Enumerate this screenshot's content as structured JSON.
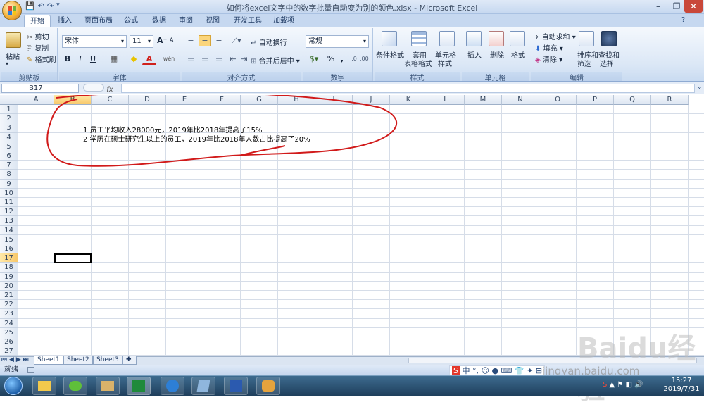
{
  "window": {
    "title": "如何将excel文字中的数字批量自动变为别的颜色.xlsx - Microsoft Excel",
    "controls": {
      "minimize": "–",
      "maximize": "❐",
      "close": "✕"
    }
  },
  "quick_access": {
    "save": "💾",
    "undo": "↶",
    "redo": "↷"
  },
  "ribbon_tabs": [
    "开始",
    "插入",
    "页面布局",
    "公式",
    "数据",
    "审阅",
    "视图",
    "开发工具",
    "加载项"
  ],
  "active_tab": "开始",
  "ribbon": {
    "clipboard": {
      "paste": "粘贴",
      "cut": "剪切",
      "copy": "复制",
      "format_painter": "格式刷",
      "label": "剪贴板"
    },
    "font": {
      "name": "宋体",
      "size": "11",
      "grow": "A⁺",
      "shrink": "A⁻",
      "bold": "B",
      "italic": "I",
      "underline": "U",
      "border": "▦",
      "fill": "◆",
      "color": "A",
      "wen": "wén",
      "label": "字体"
    },
    "alignment": {
      "wrap": "自动换行",
      "merge": "合并后居中",
      "label": "对齐方式"
    },
    "number": {
      "format": "常规",
      "percent": "%",
      "comma": ",",
      "label": "数字"
    },
    "styles": {
      "conditional": "条件格式",
      "table_format_1": "套用",
      "table_format_2": "表格格式",
      "cell_style_1": "单元格",
      "cell_style_2": "样式",
      "label": "样式"
    },
    "cells": {
      "insert": "插入",
      "delete": "删除",
      "format": "格式",
      "label": "单元格"
    },
    "editing": {
      "autosum": "自动求和",
      "fill": "填充",
      "clear": "清除",
      "sort_1": "排序和",
      "sort_2": "筛选",
      "find_1": "查找和",
      "find_2": "选择",
      "label": "编辑"
    }
  },
  "formula_bar": {
    "name_box": "B17",
    "fx": "fx",
    "formula": ""
  },
  "columns": [
    "A",
    "B",
    "C",
    "D",
    "E",
    "F",
    "G",
    "H",
    "I",
    "J",
    "K",
    "L",
    "M",
    "N",
    "O",
    "P",
    "Q",
    "R"
  ],
  "selected_column": "B",
  "rows": [
    "1",
    "2",
    "3",
    "4",
    "5",
    "6",
    "7",
    "8",
    "9",
    "10",
    "11",
    "12",
    "13",
    "14",
    "15",
    "16",
    "17",
    "18",
    "19",
    "20",
    "21",
    "22",
    "23",
    "24",
    "25",
    "26",
    "27"
  ],
  "selected_row": "17",
  "cells": {
    "B3": "1 员工平均收入28000元，2019年比2018年提高了15%",
    "B4": "2 学历在硕士研究生以上的员工，2019年比2018年人数占比提高了20%"
  },
  "sheets": [
    "Sheet1",
    "Sheet2",
    "Sheet3"
  ],
  "active_sheet": "Sheet1",
  "status": {
    "mode": "就绪"
  },
  "watermark": {
    "text": "Baidu经验",
    "url": "jingyan.baidu.com"
  },
  "ime": {
    "lang": "中"
  },
  "clock": {
    "time": "15:27",
    "date": "2019/7/31"
  }
}
